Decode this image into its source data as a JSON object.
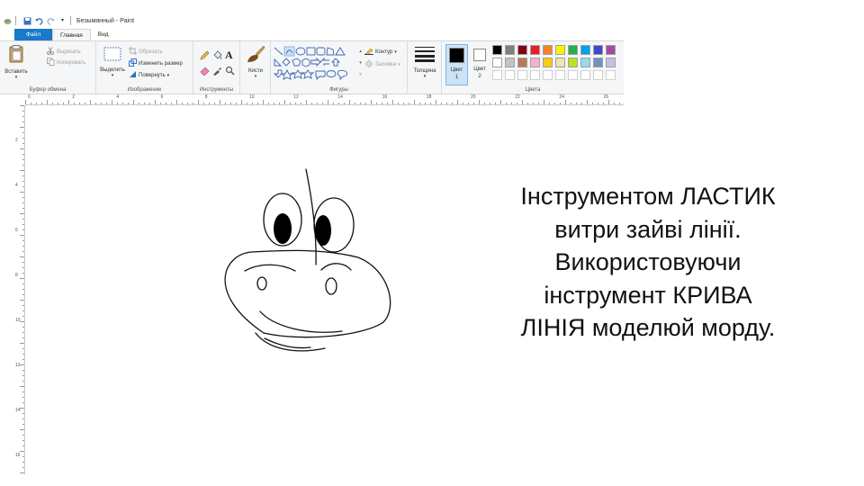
{
  "window": {
    "title": "Безымянный - Paint",
    "qa_sep": "|"
  },
  "tabs": [
    {
      "label": "Файл"
    },
    {
      "label": "Главная"
    },
    {
      "label": "Вид"
    }
  ],
  "clipboard": {
    "paste": "Вставить",
    "cut": "Вырезать",
    "copy": "Копировать",
    "group": "Буфер обмена"
  },
  "image": {
    "select": "Выделить",
    "crop": "Обрезать",
    "resize": "Изменить размер",
    "rotate": "Повернуть",
    "group": "Изображение"
  },
  "tools": {
    "group": "Инструменты",
    "text_glyph": "A"
  },
  "brushes": {
    "label": "Кисти"
  },
  "shapes": {
    "outline": "Контур",
    "fill": "Заливка",
    "group": "Фигуры"
  },
  "size": {
    "label": "Толщина"
  },
  "colors": {
    "color1": "Цвет 1",
    "color2": "Цвет 2",
    "group": "Цвета",
    "palette_row1": [
      "#000000",
      "#7f7f7f",
      "#880015",
      "#ed1c24",
      "#ff7f27",
      "#fff200",
      "#22b14c",
      "#00a2e8",
      "#3f48cc",
      "#a349a4"
    ],
    "palette_row2": [
      "#ffffff",
      "#c3c3c3",
      "#b97a57",
      "#ffaec9",
      "#ffc90e",
      "#efe4b0",
      "#b5e61d",
      "#99d9ea",
      "#7092be",
      "#c8bfe7"
    ]
  },
  "ruler": {
    "h_numbers": [
      "0",
      "2",
      "4",
      "6",
      "8",
      "10",
      "12",
      "14",
      "16",
      "18",
      "20",
      "22",
      "24",
      "26"
    ],
    "v_numbers": [
      "2",
      "4",
      "6",
      "8",
      "10",
      "12",
      "14",
      "16"
    ]
  },
  "caption": {
    "lines": [
      "Інструментом ЛАСТИК",
      "витри зайві лінії.",
      "Використовуючи",
      "інструмент КРИВА",
      "ЛІНІЯ моделюй морду."
    ]
  }
}
